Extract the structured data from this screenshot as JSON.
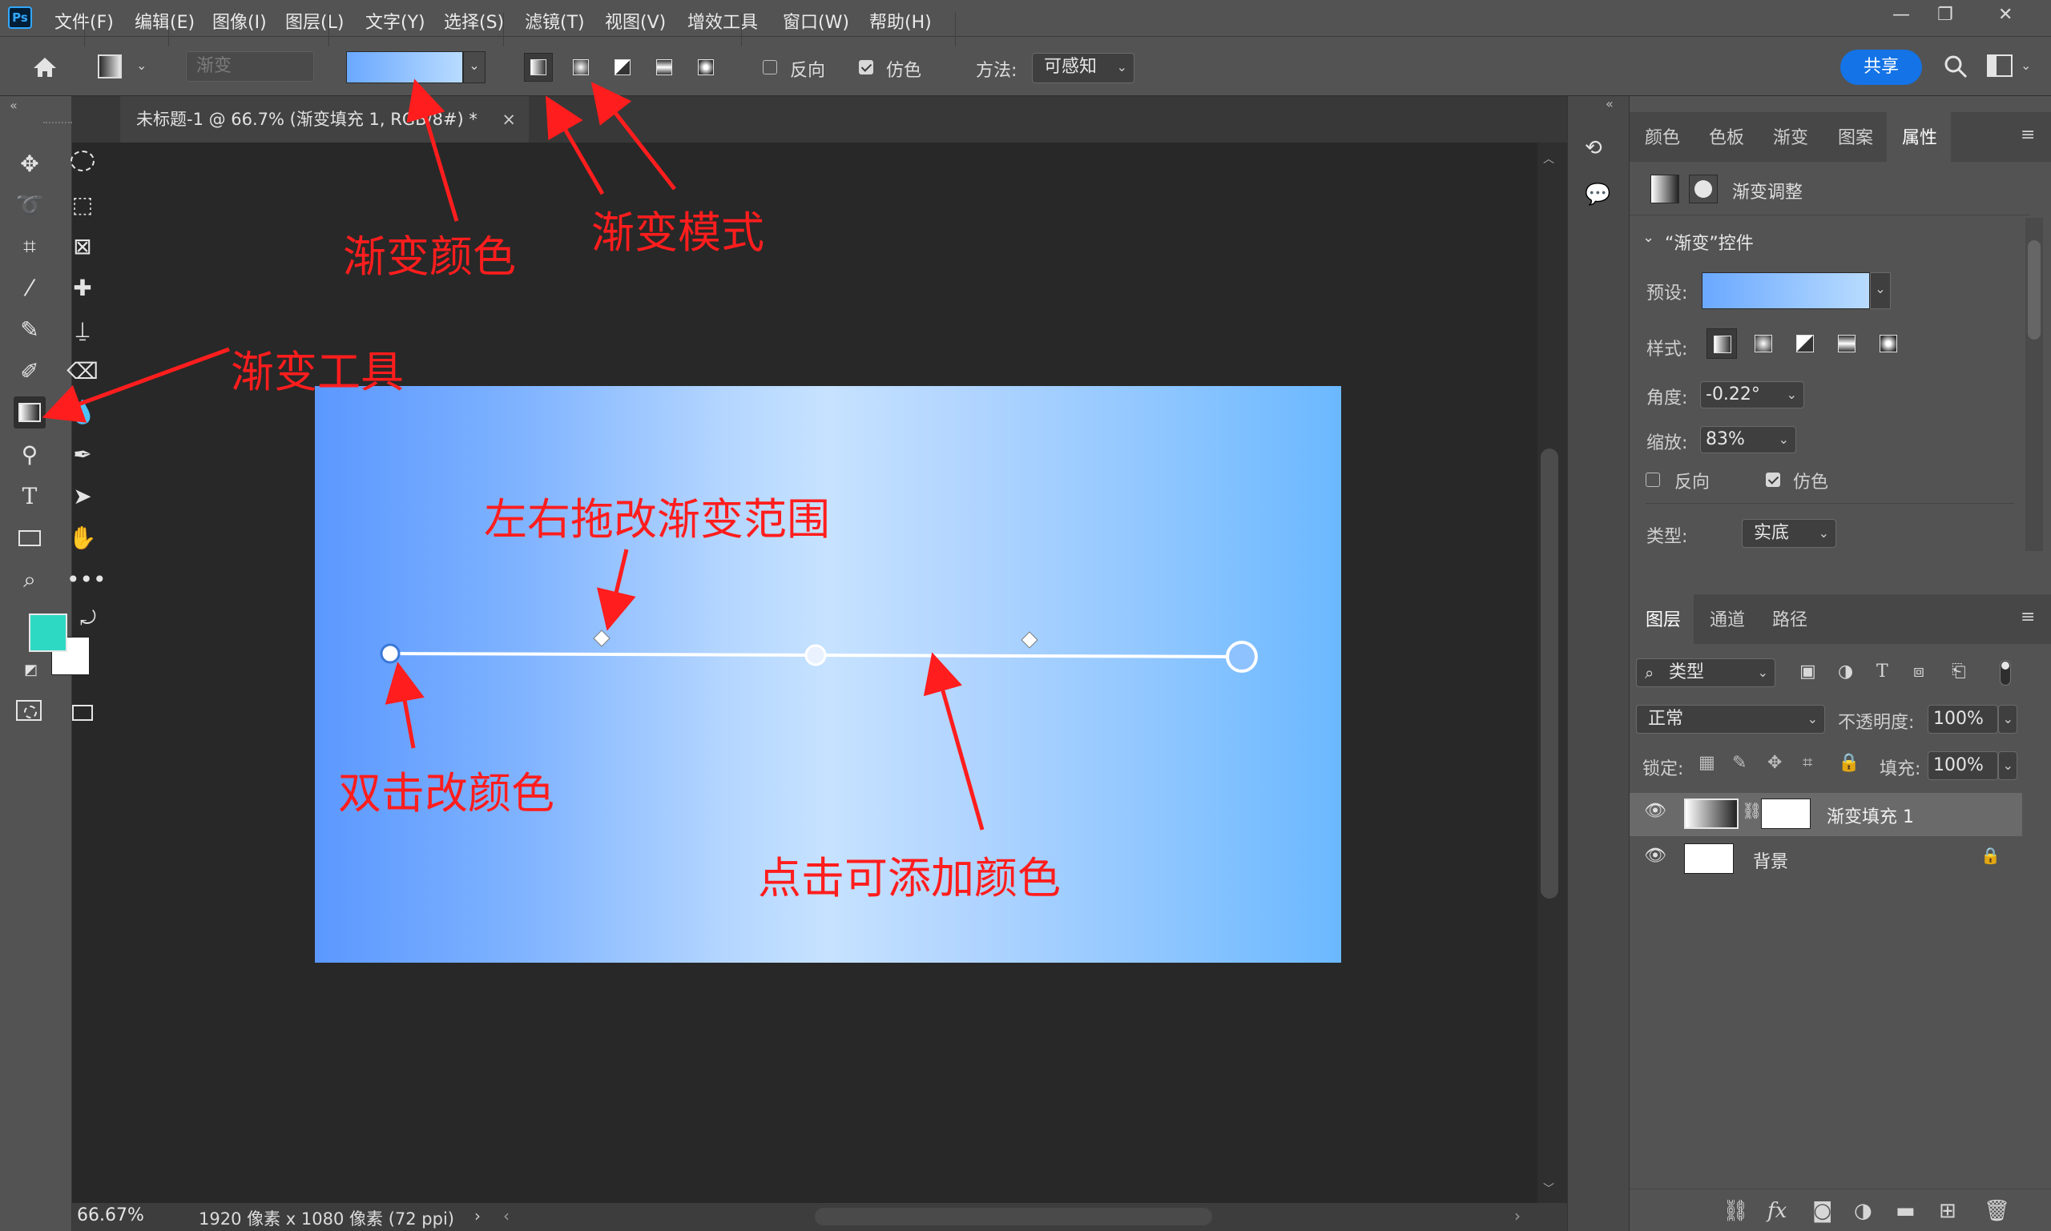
{
  "app": {
    "logo": "Ps"
  },
  "menu": [
    "文件(F)",
    "编辑(E)",
    "图像(I)",
    "图层(L)",
    "文字(Y)",
    "选择(S)",
    "滤镜(T)",
    "视图(V)",
    "增效工具",
    "窗口(W)",
    "帮助(H)"
  ],
  "window_controls": {
    "minimize": "—",
    "restore": "❐",
    "close": "✕"
  },
  "options": {
    "preset_placeholder": "渐变",
    "reverse_label": "反向",
    "reverse_checked": false,
    "dither_label": "仿色",
    "dither_checked": true,
    "method_label": "方法:",
    "method_value": "可感知",
    "share_label": "共享"
  },
  "document": {
    "tab_title": "未标题-1 @ 66.7% (渐变填充 1, RGB/8#) *",
    "close": "×",
    "zoom": "66.67%",
    "size_info": "1920 像素 x 1080 像素 (72 ppi)",
    "gradient_colors": [
      "#5b98ff",
      "#c6e2ff",
      "#6bb8ff"
    ]
  },
  "toolbar": {
    "foreground_color": "#2ed9c3",
    "background_color": "#ffffff"
  },
  "properties_panel": {
    "tabs": [
      "颜色",
      "色板",
      "渐变",
      "图案",
      "属性"
    ],
    "active_tab": "属性",
    "header": "渐变调整",
    "section_title": "“渐变”控件",
    "preset_label": "预设:",
    "style_label": "样式:",
    "angle_label": "角度:",
    "angle_value": "-0.22°",
    "scale_label": "缩放:",
    "scale_value": "83%",
    "reverse_label": "反向",
    "dither_label": "仿色",
    "type_label": "类型:",
    "type_value": "实底"
  },
  "layers_panel": {
    "tabs": [
      "图层",
      "通道",
      "路径"
    ],
    "active_tab": "图层",
    "filter_value": "类型",
    "blend_mode": "正常",
    "opacity_label": "不透明度:",
    "opacity_value": "100%",
    "lock_label": "锁定:",
    "fill_label": "填充:",
    "fill_value": "100%",
    "layers": [
      {
        "name": "渐变填充 1",
        "selected": true
      },
      {
        "name": "背景",
        "locked": true
      }
    ]
  },
  "annotations": {
    "gradient_color": "渐变颜色",
    "gradient_mode": "渐变模式",
    "gradient_tool": "渐变工具",
    "drag_range": "左右拖改渐变范围",
    "double_click_color": "双击改颜色",
    "click_add_color": "点击可添加颜色"
  }
}
